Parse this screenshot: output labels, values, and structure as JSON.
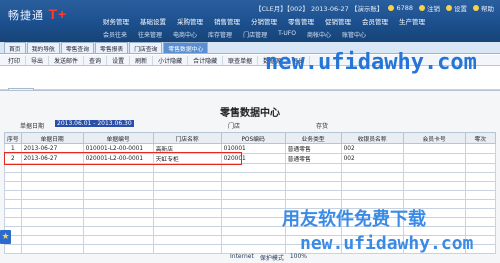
{
  "app": {
    "logo_text": "畅捷通",
    "logo_suffix": "T+",
    "status_line": "【CLE月】【002】 2013-06-27 【演示账】",
    "user_tools": [
      {
        "label": "6788",
        "icon": "user-icon"
      },
      {
        "label": "注销",
        "icon": "logout-icon"
      },
      {
        "label": "设置",
        "icon": "gear-icon"
      },
      {
        "label": "帮助",
        "icon": "help-icon"
      }
    ]
  },
  "menu_main": [
    "财务管理",
    "基础设置",
    "采购管理",
    "销售管理",
    "分销管理",
    "零售管理",
    "促销管理",
    "会员管理",
    "生产管理"
  ],
  "menu_sub": [
    "会员往来",
    "往来管理",
    "电商中心",
    "库存管理",
    "门店管理",
    "T-UFO",
    "商帐中心",
    "账管中心"
  ],
  "tabs": [
    {
      "label": "首页",
      "active": false
    },
    {
      "label": "我的导航",
      "active": false
    },
    {
      "label": "零售查询",
      "active": false
    },
    {
      "label": "零售报表",
      "active": false
    },
    {
      "label": "门店查询",
      "active": false
    },
    {
      "label": "零售数据中心",
      "active": true
    }
  ],
  "toolbar": [
    "打印",
    "导出",
    "发送邮件",
    "查询",
    "设置",
    "刷新",
    "小计隐藏",
    "合计隐藏",
    "联查单据",
    "数据源",
    "退出"
  ],
  "subtab": "报表",
  "report": {
    "title": "零售数据中心",
    "date_label": "单据日期",
    "date_value": "2013.06.01 - 2013.06.30",
    "store_label": "门店",
    "stock_label": "存货"
  },
  "columns": [
    "序号",
    "单据日期",
    "单据编号",
    "门店名称",
    "POS编码",
    "业务类型",
    "收银员名称",
    "会员卡号",
    "零次"
  ],
  "rows": [
    [
      "1",
      "2013-06-27",
      "010001-L2-00-0001",
      "高新店",
      "010001",
      "普通零售",
      "002",
      "",
      ""
    ],
    [
      "2",
      "2013-06-27",
      "020001-L2-00-0001",
      "天虹专柜",
      "020001",
      "普通零售",
      "002",
      "",
      ""
    ],
    [
      "",
      "",
      "",
      "",
      "",
      "",
      "",
      "",
      ""
    ],
    [
      "",
      "",
      "",
      "",
      "",
      "",
      "",
      "",
      ""
    ],
    [
      "",
      "",
      "",
      "",
      "",
      "",
      "",
      "",
      ""
    ],
    [
      "",
      "",
      "",
      "",
      "",
      "",
      "",
      "",
      ""
    ],
    [
      "",
      "",
      "",
      "",
      "",
      "",
      "",
      "",
      ""
    ],
    [
      "",
      "",
      "",
      "",
      "",
      "",
      "",
      "",
      ""
    ],
    [
      "",
      "",
      "",
      "",
      "",
      "",
      "",
      "",
      ""
    ],
    [
      "",
      "",
      "",
      "",
      "",
      "",
      "",
      "",
      ""
    ],
    [
      "",
      "",
      "",
      "",
      "",
      "",
      "",
      "",
      ""
    ],
    [
      "",
      "",
      "",
      "",
      "",
      "",
      "",
      "",
      ""
    ]
  ],
  "watermark": {
    "url1": "new.ufidawhy.com",
    "cn": "用友软件免费下载",
    "url2": "new.ufidawhy.com"
  },
  "taskbar": [
    "Internet",
    "保护模式",
    "100%"
  ]
}
